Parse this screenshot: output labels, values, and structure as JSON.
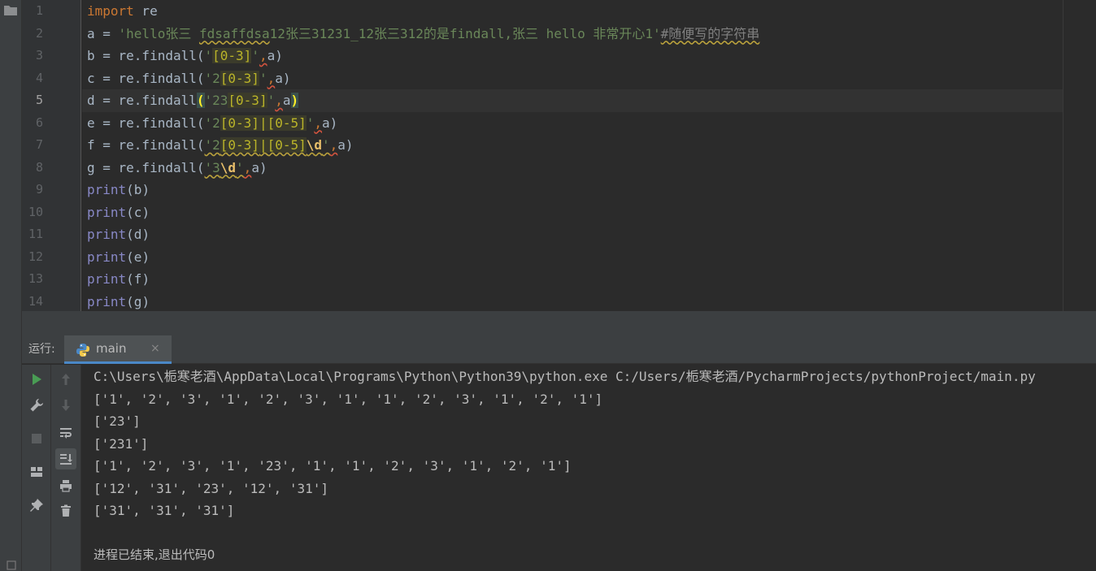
{
  "editor": {
    "line_numbers": [
      "1",
      "2",
      "3",
      "4",
      "5",
      "6",
      "7",
      "8",
      "9",
      "10",
      "11",
      "12",
      "13",
      "14"
    ],
    "current_line_index": 4,
    "code": {
      "l1_kw": "import",
      "l1_rest": " re",
      "l2_prefix": "a = ",
      "l2_str_a": "'hello张三 ",
      "l2_str_b": "fdsaffdsa",
      "l2_str_c": "12张三31231_12张三312的是findall,张三 hello 非常开心1'",
      "l2_comment": "#随便写的字符串",
      "l3_prefix": "b = re.findall(",
      "l3_q1": "'",
      "l3_rx": "[0-3]",
      "l3_q2": "'",
      "l3_comma": ",",
      "l3_suffix": "a)",
      "l4_prefix": "c = re.findall(",
      "l4_q1": "'2",
      "l4_rx": "[0-3]",
      "l4_q2": "'",
      "l4_comma": ",",
      "l4_suffix": "a)",
      "l5_prefix": "d = re.findall",
      "l5_open": "(",
      "l5_q1": "'23",
      "l5_rx": "[0-3]",
      "l5_q2": "'",
      "l5_comma": ",",
      "l5_a": "a",
      "l5_close": ")",
      "l6_prefix": "e = re.findall(",
      "l6_q1": "'2",
      "l6_rx1": "[0-3]",
      "l6_pipe": "|",
      "l6_rx2": "[0-5]",
      "l6_q2": "'",
      "l6_comma": ",",
      "l6_suffix": "a)",
      "l7_prefix": "f = re.findall(",
      "l7_q1": "'2",
      "l7_rx1": "[0-3]",
      "l7_pipe": "|",
      "l7_rx2": "[0-5]",
      "l7_esc": "\\d",
      "l7_q2": "'",
      "l7_comma": ",",
      "l7_suffix": "a)",
      "l8_prefix": "g = re.findall(",
      "l8_q1": "'3",
      "l8_esc": "\\d",
      "l8_q2": "'",
      "l8_comma": ",",
      "l8_suffix": "a)",
      "print_fn": "print",
      "l9_args": "(b)",
      "l10_args": "(c)",
      "l11_args": "(d)",
      "l12_args": "(e)",
      "l13_args": "(f)",
      "l14_args": "(g)"
    }
  },
  "run_panel": {
    "label": "运行:",
    "tab_name": "main",
    "tab_close": "×"
  },
  "toolbar_icons": {
    "run": "run-icon",
    "wrench": "wrench-icon",
    "stop": "stop-icon",
    "layout": "layout-icon",
    "pin": "pin-icon",
    "up": "arrow-up-icon",
    "down": "arrow-down-icon",
    "wrap": "soft-wrap-icon",
    "scroll_end": "scroll-to-end-icon",
    "print": "print-icon",
    "trash": "trash-icon"
  },
  "console": {
    "lines": [
      "C:\\Users\\栀寒老酒\\AppData\\Local\\Programs\\Python\\Python39\\python.exe C:/Users/栀寒老酒/PycharmProjects/pythonProject/main.py",
      "['1', '2', '3', '1', '2', '3', '1', '1', '2', '3', '1', '2', '1']",
      "['23']",
      "['231']",
      "['1', '2', '3', '1', '23', '1', '1', '2', '3', '1', '2', '1']",
      "['12', '31', '23', '12', '31']",
      "['31', '31', '31']",
      "",
      "进程已结束,退出代码0"
    ]
  },
  "colors": {
    "editor_bg": "#2b2b2b",
    "panel_bg": "#3c3f41",
    "keyword": "#cc7832",
    "string": "#6a8759",
    "builtin": "#8888c6",
    "comment": "#808080",
    "run_green": "#499c54"
  }
}
